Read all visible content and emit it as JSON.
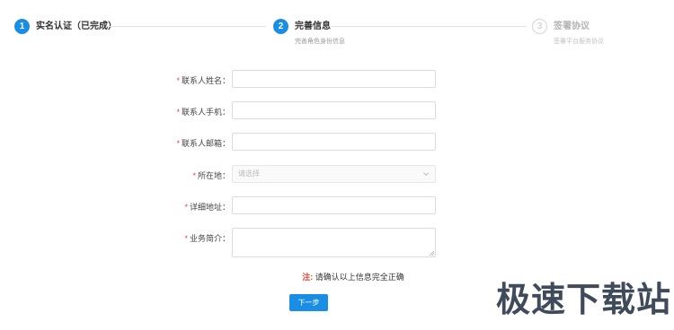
{
  "steps": [
    {
      "number": "1",
      "title": "实名认证（已完成）",
      "desc": "",
      "state": "done"
    },
    {
      "number": "2",
      "title": "完善信息",
      "desc": "完善角色身份信息",
      "state": "current"
    },
    {
      "number": "3",
      "title": "签署协议",
      "desc": "签署平台服务协议",
      "state": "pending"
    }
  ],
  "form": {
    "contact_name": {
      "required_mark": "*",
      "label": "联系人姓名：",
      "value": ""
    },
    "contact_phone": {
      "required_mark": "*",
      "label": "联系人手机：",
      "value": ""
    },
    "contact_email": {
      "required_mark": "*",
      "label": "联系人邮箱：",
      "value": ""
    },
    "location": {
      "required_mark": "*",
      "label": "所在地：",
      "placeholder": "请选择"
    },
    "address": {
      "required_mark": "*",
      "label": "详细地址：",
      "value": ""
    },
    "business_intro": {
      "required_mark": "*",
      "label": "业务简介：",
      "value": ""
    }
  },
  "note": {
    "prefix": "注:",
    "text": "请确认以上信息完全正确"
  },
  "next_button": {
    "label": "下一步"
  },
  "watermark": {
    "text": "极速下载站"
  },
  "colors": {
    "accent": "#1a8ee5",
    "required": "#e5483d"
  }
}
